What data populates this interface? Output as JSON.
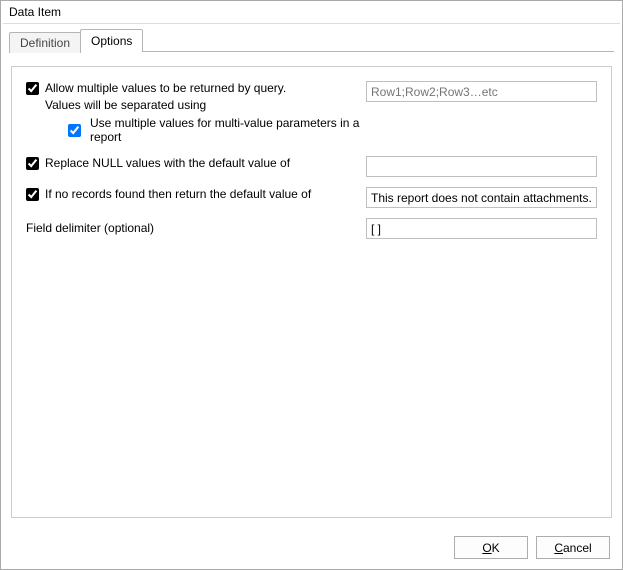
{
  "window": {
    "title": "Data Item"
  },
  "tabs": {
    "definition": "Definition",
    "options": "Options",
    "active": "Options"
  },
  "options": {
    "allowMultiple": {
      "checked": true,
      "label": "Allow multiple values to be returned by query.",
      "separatorNote": "Values will be separated using",
      "useMultiParams": {
        "checked": true,
        "label": "Use multiple values for multi-value parameters in a report"
      },
      "placeholder": "Row1;Row2;Row3…etc",
      "value": ""
    },
    "replaceNull": {
      "checked": true,
      "label": "Replace NULL values with the default value of",
      "value": ""
    },
    "noRecords": {
      "checked": true,
      "label": "If no records found then return the default value of",
      "value": "This report does not contain attachments."
    },
    "fieldDelimiter": {
      "label": "Field delimiter (optional)",
      "value": "[ ]"
    }
  },
  "buttons": {
    "ok": "OK",
    "cancel": "Cancel",
    "ok_u": "O",
    "ok_rest": "K",
    "cancel_u": "C",
    "cancel_rest": "ancel"
  }
}
